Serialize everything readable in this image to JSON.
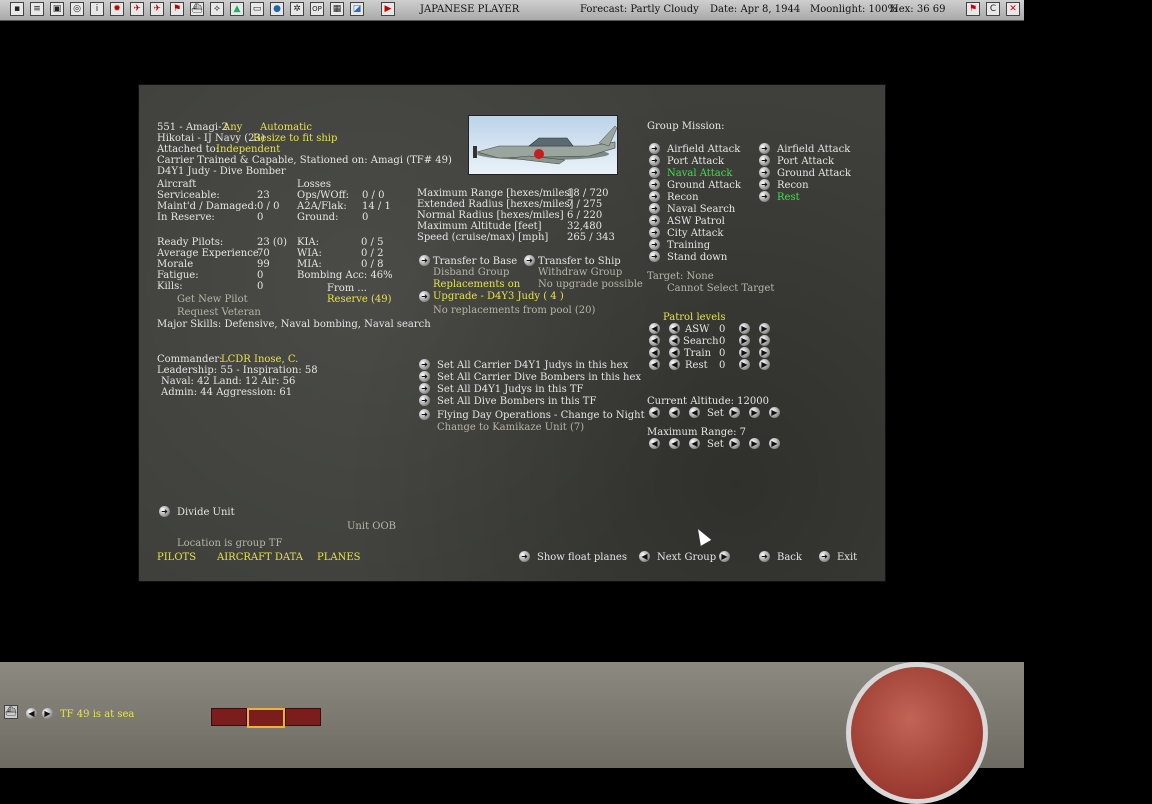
{
  "topbar": {
    "player": "JAPANESE PLAYER",
    "forecast": "Forecast: Partly Cloudy",
    "date": "Date: Apr 8, 1944",
    "moonlight": "Moonlight: 100%",
    "hex": "Hex: 36 69"
  },
  "unit": {
    "name": "551 - Amagi-2",
    "any": "Any",
    "automatic": "Automatic",
    "hikotai": "Hikotai - IJ Navy (23)",
    "resize": "Resize to fit ship",
    "attached_label": "Attached to:",
    "attached_value": "Independent",
    "carrier_line": "Carrier Trained & Capable, Stationed on: Amagi (TF# 49)",
    "aircraft_type": "D4Y1 Judy - Dive Bomber"
  },
  "aircraft_stats": {
    "header": "Aircraft",
    "rows": [
      {
        "label": "Serviceable:",
        "value": "23"
      },
      {
        "label": "Maint'd / Damaged:",
        "value": "0 / 0"
      },
      {
        "label": "In Reserve:",
        "value": "0"
      }
    ]
  },
  "losses": {
    "header": "Losses",
    "rows": [
      {
        "label": "Ops/WOff:",
        "value": "0 / 0"
      },
      {
        "label": "A2A/Flak:",
        "value": "14 / 1"
      },
      {
        "label": "Ground:",
        "value": "0"
      }
    ]
  },
  "pilots": {
    "rows": [
      {
        "label": "Ready Pilots:",
        "value": "23 (0)"
      },
      {
        "label": "Average Experience",
        "value": "70"
      },
      {
        "label": "Morale",
        "value": "99"
      },
      {
        "label": "Fatigue:",
        "value": "0"
      },
      {
        "label": "Kills:",
        "value": "0"
      }
    ],
    "casualties": [
      {
        "label": "KIA:",
        "value": "0 / 5"
      },
      {
        "label": "WIA:",
        "value": "0 / 2"
      },
      {
        "label": "MIA:",
        "value": "0 / 8"
      }
    ],
    "bombing_acc": "Bombing Acc: 46%",
    "get_new_pilot": "Get New Pilot",
    "request_veteran": "Request Veteran",
    "from": "From ...",
    "reserve": "Reserve (49)",
    "major_skills": "Major Skills:  Defensive, Naval bombing, Naval search"
  },
  "commander": {
    "label": "Commander:",
    "name": "LCDR Inose, C.",
    "leadership": "Leadership: 55 - Inspiration: 58",
    "naval_land_air": "Naval: 42  Land: 12  Air: 56",
    "admin_aggr": "Admin: 44  Aggression: 61"
  },
  "performance": {
    "rows": [
      {
        "label": "Maximum Range [hexes/miles]",
        "value": "18 / 720"
      },
      {
        "label": "Extended Radius [hexes/miles]",
        "value": "7 / 275"
      },
      {
        "label": "Normal Radius [hexes/miles]",
        "value": "6 / 220"
      },
      {
        "label": "Maximum Altitude [feet]",
        "value": "32,480"
      },
      {
        "label": "Speed (cruise/max) [mph]",
        "value": "265 / 343"
      }
    ]
  },
  "actions": {
    "transfer_base": "Transfer to Base",
    "transfer_ship": "Transfer to Ship",
    "disband": "Disband Group",
    "withdraw": "Withdraw Group",
    "replacements": "Replacements on",
    "no_upgrade": "No upgrade possible",
    "upgrade": "Upgrade - D4Y3 Judy  ( 4 )",
    "no_replacements": "No replacements from pool (20)",
    "set_carrier_judys": "Set All Carrier D4Y1 Judys in this hex",
    "set_carrier_dive": "Set All Carrier Dive Bombers in this hex",
    "set_judys_tf": "Set All D4Y1 Judys in this TF",
    "set_dive_tf": "Set All Dive Bombers in this TF",
    "flying_day": "Flying Day Operations - Change to Night",
    "kamikaze": "Change to Kamikaze Unit (7)"
  },
  "mission": {
    "header": "Group Mission:",
    "col1": [
      "Airfield Attack",
      "Port Attack",
      "Naval Attack",
      "Ground Attack",
      "Recon",
      "Naval Search",
      "ASW Patrol",
      "City Attack",
      "Training",
      "Stand down"
    ],
    "col2": [
      "Airfield Attack",
      "Port Attack",
      "Ground Attack",
      "Recon",
      "Rest"
    ],
    "target": "Target: None",
    "cannot_select": "Cannot Select Target"
  },
  "patrol": {
    "header": "Patrol levels",
    "rows": [
      {
        "label": "ASW",
        "value": "0"
      },
      {
        "label": "Search",
        "value": "0"
      },
      {
        "label": "Train",
        "value": "0"
      },
      {
        "label": "Rest",
        "value": "0"
      }
    ]
  },
  "altitude": {
    "current": "Current Altitude: 12000",
    "max_range": "Maximum Range: 7",
    "set": "Set"
  },
  "bottom_panel": {
    "divide": "Divide Unit",
    "unit_oob": "Unit OOB",
    "location": "Location is group TF",
    "tab_pilots": "PILOTS",
    "tab_aircraft": "AIRCRAFT DATA",
    "tab_planes": "PLANES",
    "show_float": "Show float planes",
    "next_group": "Next Group",
    "back": "Back",
    "exit": "Exit"
  },
  "statusbar": {
    "tf_status": "TF 49 is at sea"
  },
  "colors": {
    "accent_yellow": "#e8e34a",
    "accent_green": "#3ee04a",
    "panel_bg": "#3f403b"
  }
}
